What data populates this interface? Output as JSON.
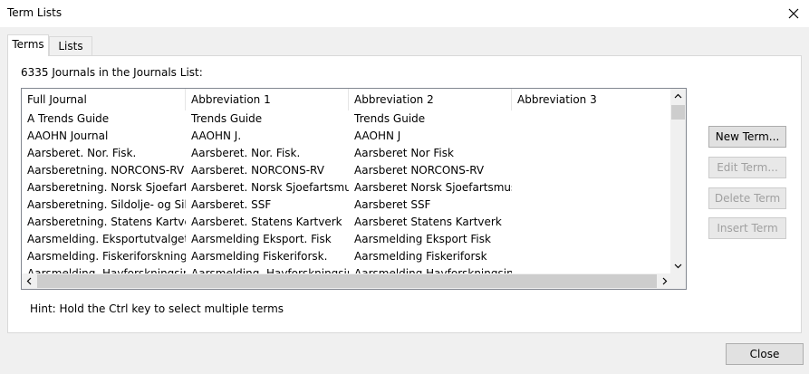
{
  "window": {
    "title": "Term Lists"
  },
  "tabs": [
    {
      "label": "Terms"
    },
    {
      "label": "Lists"
    }
  ],
  "terms_panel": {
    "count_label": "6335 Journals in the Journals List:",
    "columns": [
      "Full Journal",
      "Abbreviation 1",
      "Abbreviation 2",
      "Abbreviation 3"
    ],
    "rows": [
      [
        "A Trends Guide",
        "Trends Guide",
        "Trends Guide",
        ""
      ],
      [
        "AAOHN Journal",
        "AAOHN J.",
        "AAOHN J",
        ""
      ],
      [
        "Aarsberet. Nor. Fisk.",
        "Aarsberet. Nor. Fisk.",
        "Aarsberet Nor Fisk",
        ""
      ],
      [
        "Aarsberetning. NORCONS-RV",
        "Aarsberet. NORCONS-RV",
        "Aarsberet NORCONS-RV",
        ""
      ],
      [
        "Aarsberetning. Norsk Sjoefarts...",
        "Aarsberet. Norsk Sjoefartsmus.",
        "Aarsberet Norsk Sjoefartsmus",
        ""
      ],
      [
        "Aarsberetning. Sildolje- og Sil...",
        "Aarsberet. SSF",
        "Aarsberet SSF",
        ""
      ],
      [
        "Aarsberetning. Statens Kartverk",
        "Aarsberet. Statens Kartverk",
        "Aarsberet Statens Kartverk",
        ""
      ],
      [
        "Aarsmelding. Eksportutvalget ...",
        "Aarsmelding Eksport. Fisk",
        "Aarsmelding Eksport Fisk",
        ""
      ],
      [
        "Aarsmelding. Fiskeriforskning",
        "Aarsmelding Fiskeriforsk.",
        "Aarsmelding Fiskeriforsk",
        ""
      ],
      [
        "Aarsmelding. Havforskningsinst...",
        "Aarsmelding. Havforskningsinst.",
        "Aarsmelding Havforskningsinst",
        ""
      ]
    ],
    "hint": "Hint: Hold the Ctrl key to select multiple terms"
  },
  "buttons": {
    "new_term": "New Term...",
    "edit_term": "Edit Term...",
    "delete_term": "Delete Term",
    "insert_term": "Insert Term",
    "close": "Close"
  }
}
